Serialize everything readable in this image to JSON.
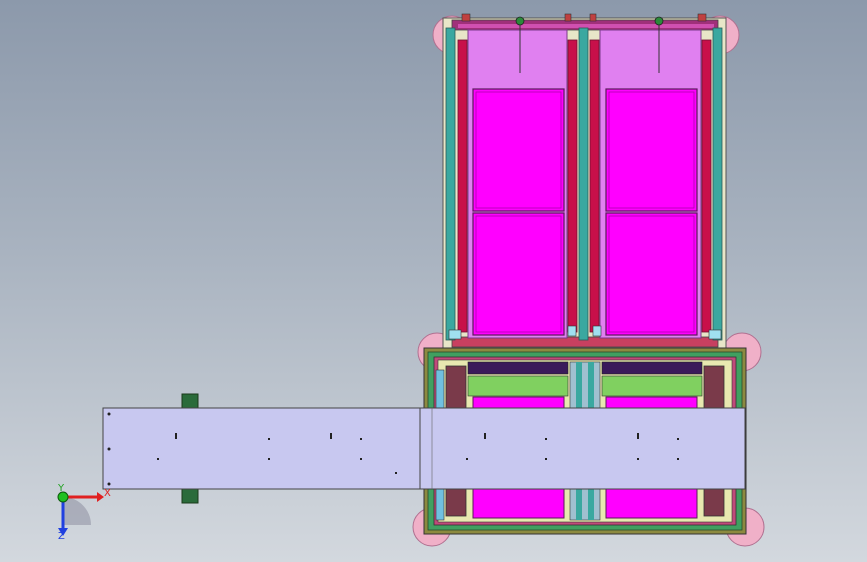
{
  "viewport": {
    "background_top": "#8c99ab",
    "background_bottom": "#d3d8de"
  },
  "colors": {
    "magenta_panel": "#ff00ff",
    "lilac_frame": "#e080f0",
    "crimson_rail": "#c8104a",
    "teal_rail": "#3aa8a0",
    "green_beam": "#40a060",
    "conveyor_plate": "#c8c8f0",
    "pink_caster": "#f0b0c8",
    "olive_frame": "#8c8a40",
    "dark_green_block": "#2a6b3a",
    "yellow_guard": "#e8e8b0"
  },
  "triad": {
    "x_label": "X",
    "y_label": "Y",
    "z_label": "Z",
    "x_color": "#e02020",
    "y_color": "#20c020",
    "z_color": "#2040e0"
  }
}
